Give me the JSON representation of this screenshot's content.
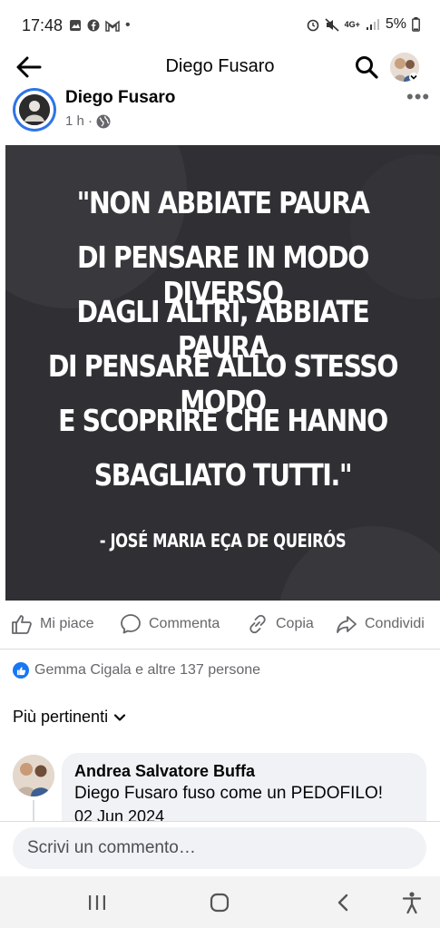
{
  "status_bar": {
    "time": "17:48",
    "battery": "5%",
    "network": "4G+"
  },
  "header": {
    "title": "Diego Fusaro",
    "back_icon": "arrow-left-icon",
    "search_icon": "search-icon"
  },
  "post": {
    "author": "Diego Fusaro",
    "time": "1 h ·",
    "more": "•••",
    "quote_lines": [
      "\"NON ABBIATE PAURA",
      "DI PENSARE IN MODO DIVERSO",
      "DAGLI ALTRI, ABBIATE PAURA",
      "DI PENSARE ALLO STESSO MODO",
      "E SCOPRIRE CHE HANNO",
      "SBAGLIATO TUTTI.\""
    ],
    "quote_author": "- JOSÉ MARIA EÇA DE QUEIRÓS"
  },
  "actions": {
    "like": "Mi piace",
    "comment": "Commenta",
    "copy": "Copia",
    "share": "Condividi"
  },
  "reactions": {
    "text": "Gemma Cigala e altre 137 persone"
  },
  "sort": {
    "label": "Più pertinenti"
  },
  "comment": {
    "author": "Andrea Salvatore Buffa",
    "text": "Diego Fusaro fuso come un PEDOFILO!",
    "date": "02 Jun 2024"
  },
  "composer": {
    "placeholder": "Scrivi un commento…"
  },
  "colors": {
    "brand_blue": "#1877f2",
    "quote_bg": "#2f2f34",
    "muted_text": "#65676b"
  }
}
